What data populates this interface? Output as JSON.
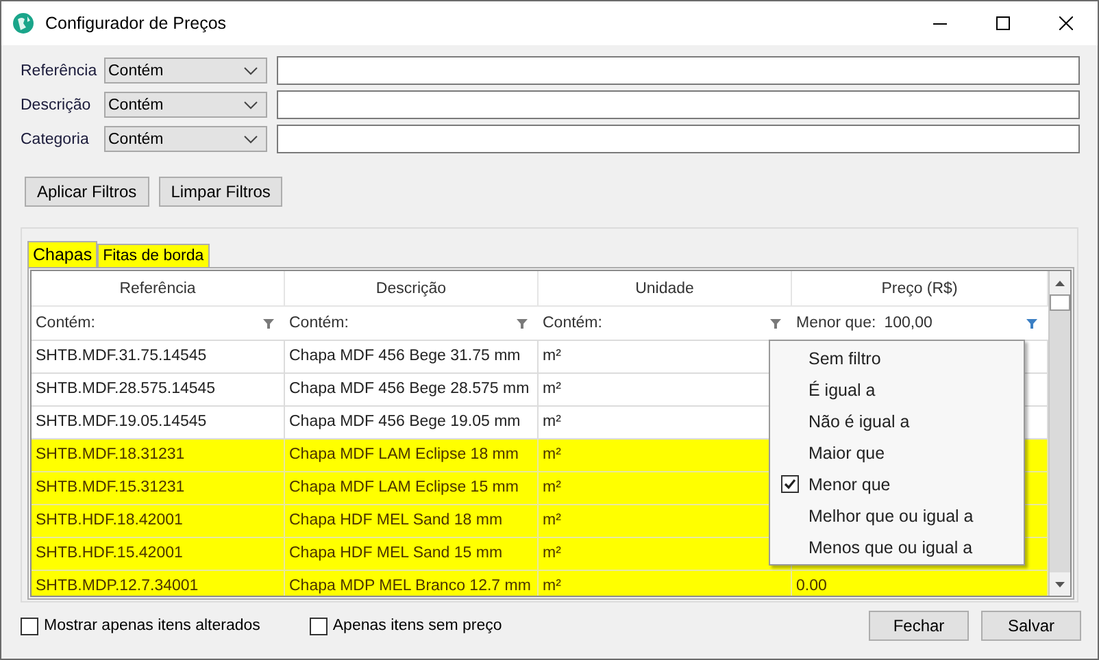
{
  "window": {
    "title": "Configurador de Preços"
  },
  "filters": [
    {
      "label": "Referência",
      "operator": "Contém"
    },
    {
      "label": "Descrição",
      "operator": "Contém"
    },
    {
      "label": "Categoria",
      "operator": "Contém"
    }
  ],
  "filter_buttons": [
    "Aplicar Filtros",
    "Limpar Filtros"
  ],
  "tabs": [
    {
      "label": "Chapas",
      "selected": true,
      "highlighted": true
    },
    {
      "label": "Fitas de borda",
      "selected": false,
      "highlighted": true
    }
  ],
  "grid": {
    "columns": [
      {
        "label": "Referência",
        "filter": "Contém:",
        "filter_active": false
      },
      {
        "label": "Descrição",
        "filter": "Contém:",
        "filter_active": false
      },
      {
        "label": "Unidade",
        "filter": "Contém:",
        "filter_active": false
      },
      {
        "label": "Preço (R$)",
        "filter": "Menor que:",
        "filter_value": "100,00",
        "filter_active": true
      }
    ],
    "rows": [
      {
        "cells": [
          "SHTB.MDF.31.75.14545",
          "Chapa MDF 456 Bege 31.75 mm",
          "m²"
        ],
        "highlighted": false
      },
      {
        "cells": [
          "SHTB.MDF.28.575.14545",
          "Chapa MDF 456 Bege 28.575 mm",
          "m²"
        ],
        "highlighted": false
      },
      {
        "cells": [
          "SHTB.MDF.19.05.14545",
          "Chapa MDF 456 Bege 19.05 mm",
          "m²"
        ],
        "highlighted": false
      },
      {
        "cells": [
          "SHTB.MDF.18.31231",
          "Chapa MDF LAM Eclipse 18 mm",
          "m²"
        ],
        "highlighted": true
      },
      {
        "cells": [
          "SHTB.MDF.15.31231",
          "Chapa MDF LAM Eclipse 15 mm",
          "m²"
        ],
        "highlighted": true
      },
      {
        "cells": [
          "SHTB.HDF.18.42001",
          "Chapa HDF MEL Sand 18 mm",
          "m²"
        ],
        "highlighted": true
      },
      {
        "cells": [
          "SHTB.HDF.15.42001",
          "Chapa HDF MEL Sand 15 mm",
          "m²"
        ],
        "highlighted": true
      },
      {
        "cells": [
          "SHTB.MDP.12.7.34001",
          "Chapa MDP MEL Branco 12.7 mm",
          "m²",
          "0.00"
        ],
        "highlighted": true
      }
    ]
  },
  "filter_menu": {
    "items": [
      {
        "label": "Sem filtro",
        "selected": false
      },
      {
        "label": "É igual a",
        "selected": false
      },
      {
        "label": "Não é igual a",
        "selected": false
      },
      {
        "label": "Maior que",
        "selected": false
      },
      {
        "label": "Menor que",
        "selected": true
      },
      {
        "label": "Melhor que ou igual a",
        "selected": false
      },
      {
        "label": "Menos que ou igual a",
        "selected": false
      }
    ]
  },
  "options": [
    {
      "label": "Mostrar apenas itens alterados",
      "checked": false
    },
    {
      "label": "Apenas itens sem preço",
      "checked": false
    }
  ],
  "buttons": [
    "Fechar",
    "Salvar"
  ]
}
